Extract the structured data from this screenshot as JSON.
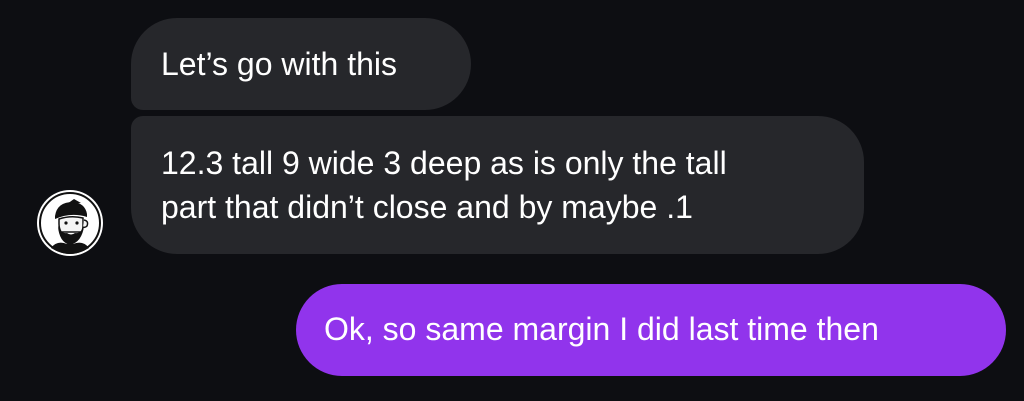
{
  "conversation": {
    "messages": [
      {
        "sender": "contact",
        "text": "Let’s go with this"
      },
      {
        "sender": "contact",
        "lines": [
          "12.3 tall 9 wide 3 deep as is only the tall",
          "part that didn’t close and by maybe .1"
        ]
      },
      {
        "sender": "me",
        "text": "Ok, so same margin I did last time then"
      }
    ],
    "avatar": {
      "icon": "bearded-man-avatar-icon"
    }
  },
  "colors": {
    "background": "#0d0e12",
    "incoming_bubble": "#26272b",
    "outgoing_bubble": "#9134ec",
    "text": "#ffffff"
  }
}
